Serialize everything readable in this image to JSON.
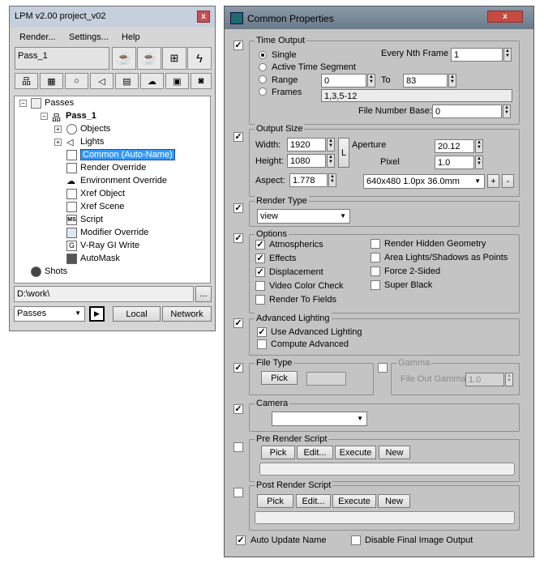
{
  "lpm": {
    "title": "LPM v2.00    project_v02",
    "close": "x",
    "menu": [
      "Render...",
      "Settings...",
      "Help"
    ],
    "pass_field": "Pass_1",
    "tree": {
      "root": "Passes",
      "pass": "Pass_1",
      "items": [
        "Objects",
        "Lights",
        "Common (Auto-Name)",
        "Render Override",
        "Environment Override",
        "Xref Object",
        "Xref Scene",
        "Script",
        "Modifier Override",
        "V-Ray GI Write",
        "AutoMask"
      ],
      "shots": "Shots"
    },
    "path": "D:\\work\\",
    "path_btn": "...",
    "passes_select": "Passes",
    "local": "Local",
    "network": "Network"
  },
  "cp": {
    "title": "Common Properties",
    "close": "x",
    "time_output": {
      "label": "Time Output",
      "single": "Single",
      "active": "Active Time Segment",
      "range": "Range",
      "frames": "Frames",
      "every_nth_label": "Every Nth Frame",
      "every_nth": "1",
      "range_from": "0",
      "to": "To",
      "range_to": "83",
      "frames_value": "1,3,5-12",
      "file_number_base_label": "File Number Base:",
      "file_number_base": "0"
    },
    "output_size": {
      "label": "Output Size",
      "width_label": "Width:",
      "width": "1920",
      "height_label": "Height:",
      "height": "1080",
      "lock": "L",
      "aperture_label": "Aperture",
      "aperture": "20.12",
      "pixel_label": "Pixel",
      "pixel": "1.0",
      "aspect_label": "Aspect:",
      "aspect": "1.778",
      "preset": "640x480 1.0px 36.0mm",
      "plus": "+",
      "minus": "-"
    },
    "render_type": {
      "label": "Render Type",
      "value": "view"
    },
    "options": {
      "label": "Options",
      "left": [
        {
          "text": "Atmospherics",
          "checked": true
        },
        {
          "text": "Effects",
          "checked": true
        },
        {
          "text": "Displacement",
          "checked": true
        },
        {
          "text": "Video Color Check",
          "checked": false
        },
        {
          "text": "Render To Fields",
          "checked": false
        }
      ],
      "right": [
        {
          "text": "Render Hidden Geometry",
          "checked": false
        },
        {
          "text": "Area Lights/Shadows as Points",
          "checked": false
        },
        {
          "text": "Force 2-Sided",
          "checked": false
        },
        {
          "text": "Super Black",
          "checked": false
        }
      ]
    },
    "advanced_lighting": {
      "label": "Advanced Lighting",
      "use": "Use Advanced Lighting",
      "compute": "Compute Advanced"
    },
    "file_type": {
      "label": "File Type",
      "pick": "Pick"
    },
    "gamma": {
      "label": "Gamma",
      "file_out_label": "File Out Gamma",
      "value": "1.0"
    },
    "camera": {
      "label": "Camera"
    },
    "pre_render": {
      "label": "Pre Render Script",
      "pick": "Pick",
      "edit": "Edit...",
      "execute": "Execute",
      "new": "New"
    },
    "post_render": {
      "label": "Post Render Script",
      "pick": "Pick",
      "edit": "Edit...",
      "execute": "Execute",
      "new": "New"
    },
    "auto_update": "Auto Update Name",
    "disable_final": "Disable Final Image Output"
  }
}
